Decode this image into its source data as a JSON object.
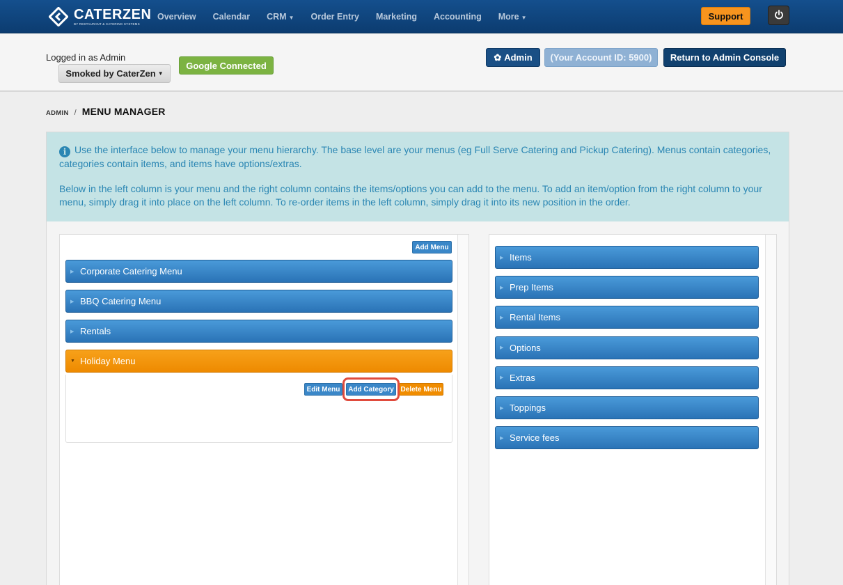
{
  "app": {
    "logo_name": "CATERZEN",
    "logo_sub": "BY RESTAURANT & CATERING SYSTEMS"
  },
  "nav": {
    "links": [
      {
        "label": "Overview",
        "has_caret": false
      },
      {
        "label": "Calendar",
        "has_caret": false
      },
      {
        "label": "CRM",
        "has_caret": true
      },
      {
        "label": "Order Entry",
        "has_caret": false
      },
      {
        "label": "Marketing",
        "has_caret": false
      },
      {
        "label": "Accounting",
        "has_caret": false
      },
      {
        "label": "More",
        "has_caret": true
      }
    ],
    "support_label": "Support"
  },
  "subheader": {
    "logged_in_text": "Logged in as Admin",
    "account_name": "Smoked by CaterZen",
    "google_status": "Google Connected",
    "admin_label": "Admin",
    "account_id_label": "(Your Account ID: 5900)",
    "return_label": "Return to Admin Console"
  },
  "breadcrumb": {
    "parent": "ADMIN",
    "separator": "/",
    "current": "MENU MANAGER"
  },
  "info": {
    "paragraph_1": "Use the interface below to manage your menu hierarchy. The base level are your menus (eg Full Serve Catering and Pickup Catering). Menus contain categories, categories contain items, and items have options/extras.",
    "paragraph_2": "Below in the left column is your menu and the right column contains the items/options you can add to the menu. To add an item/option from the right column to your menu, simply drag it into place on the left column. To re-order items in the left column, simply drag it into its new position in the order."
  },
  "left_column": {
    "add_menu_label": "Add Menu",
    "menus": [
      {
        "label": "Corporate Catering Menu",
        "expanded": false
      },
      {
        "label": "BBQ Catering Menu",
        "expanded": false
      },
      {
        "label": "Rentals",
        "expanded": false
      },
      {
        "label": "Holiday Menu",
        "expanded": true
      }
    ],
    "expanded_actions": {
      "edit_label": "Edit Menu",
      "add_category_label": "Add Category",
      "delete_label": "Delete Menu"
    }
  },
  "right_column": {
    "groups": [
      "Items",
      "Prep Items",
      "Rental Items",
      "Options",
      "Extras",
      "Toppings",
      "Service fees"
    ]
  },
  "colors": {
    "navbar": "#144f8d",
    "accent_orange": "#f7941e",
    "menu_blue": "#2a73b6",
    "active_orange": "#ee8a00",
    "google_green": "#7cb342",
    "highlight_red": "#e04b3d",
    "info_bg": "#c4e3e5"
  }
}
